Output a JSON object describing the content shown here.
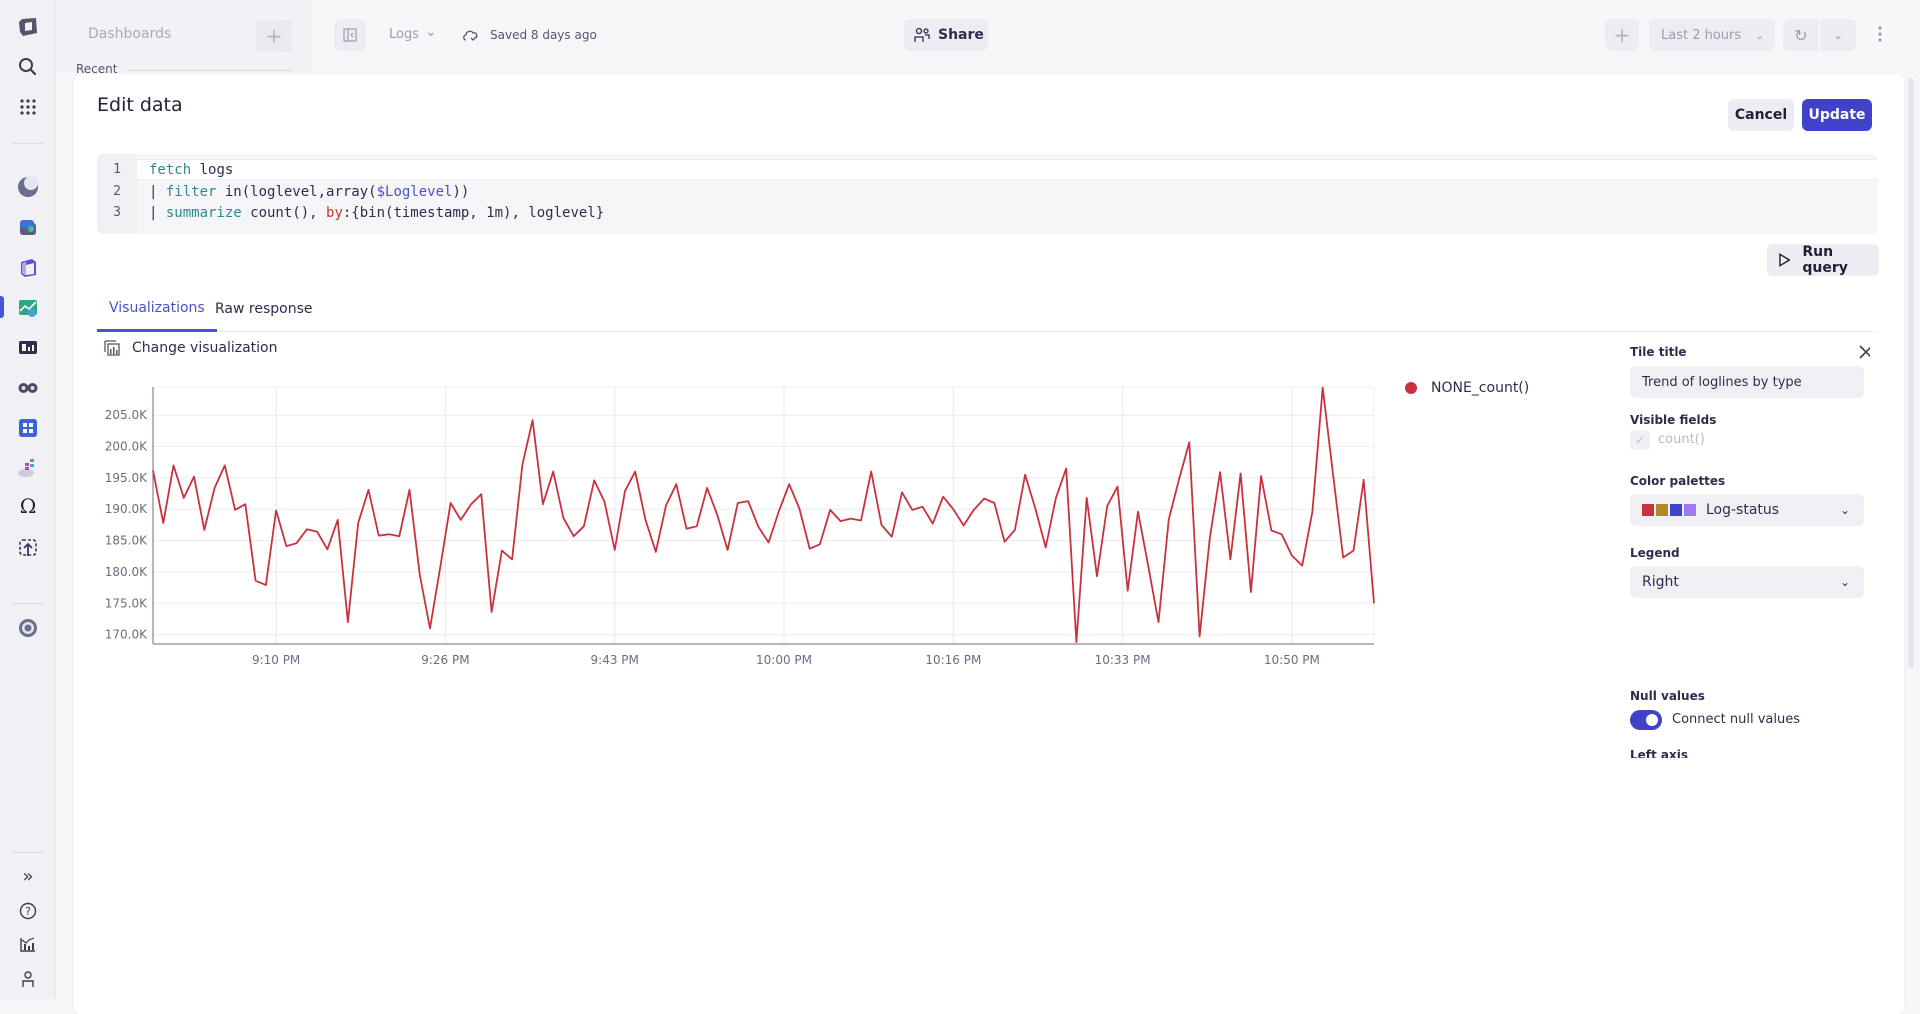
{
  "rail": {
    "icons": [
      "app-logo-icon",
      "search-icon",
      "apps-grid-icon",
      "discover-icon",
      "kubernetes-icon",
      "infrastructure-icon",
      "dashboards-icon",
      "notebooks-icon",
      "observability-icon",
      "workflows-icon",
      "services-icon",
      "omega-icon",
      "upload-icon",
      "settings-icon"
    ],
    "bottom_icons": [
      "expand-icon",
      "help-icon",
      "usage-icon",
      "user-icon"
    ]
  },
  "sidepanel": {
    "title": "Dashboards",
    "recent_label": "Recent"
  },
  "topbar": {
    "dashboard_name": "Logs",
    "saved_status": "Saved 8 days ago",
    "share_label": "Share",
    "timeframe": "Last 2 hours"
  },
  "modal": {
    "title": "Edit data",
    "cancel_label": "Cancel",
    "update_label": "Update",
    "run_query_label": "Run query",
    "code_lines": [
      {
        "num": "1"
      },
      {
        "num": "2"
      },
      {
        "num": "3"
      }
    ],
    "code": {
      "l1_kw": "fetch",
      "l1_rest": " logs",
      "l2_pipe": "| ",
      "l2_kw": "filter",
      "l2_a": " in(loglevel,array(",
      "l2_var": "$Loglevel",
      "l2_b": "))",
      "l3_pipe": "| ",
      "l3_kw": "summarize",
      "l3_a": " count(), ",
      "l3_by": "by",
      "l3_b": ":{bin(timestamp, 1m), loglevel}"
    },
    "tabs": [
      {
        "label": "Visualizations",
        "active": true
      },
      {
        "label": "Raw response",
        "active": false
      }
    ],
    "change_viz_label": "Change visualization"
  },
  "config": {
    "tile_title_label": "Tile title",
    "tile_title_value": "Trend of loglines by type",
    "visible_fields_label": "Visible fields",
    "visible_field": "count()",
    "color_palettes_label": "Color palettes",
    "color_palette_value": "Log-status",
    "palette_colors": [
      "#c8323f",
      "#b8862a",
      "#4043c9",
      "#9b7cf0"
    ],
    "legend_label": "Legend",
    "legend_value": "Right",
    "null_values_label": "Null values",
    "connect_null_label": "Connect null values",
    "connect_null_on": true,
    "left_axis_label": "Left axis"
  },
  "chart_data": {
    "type": "line",
    "title": "",
    "xlabel": "",
    "ylabel": "",
    "ylim": [
      168500,
      209500
    ],
    "yticks": [
      170000,
      175000,
      180000,
      185000,
      190000,
      195000,
      200000,
      205000
    ],
    "ytick_labels": [
      "170.0K",
      "175.0K",
      "180.0K",
      "185.0K",
      "190.0K",
      "195.0K",
      "200.0K",
      "205.0K"
    ],
    "xtick_labels": [
      "9:10 PM",
      "9:26 PM",
      "9:43 PM",
      "10:00 PM",
      "10:16 PM",
      "10:33 PM",
      "10:50 PM"
    ],
    "xtick_minutes": [
      12,
      28.5,
      45,
      61.5,
      78,
      94.5,
      111
    ],
    "x_start": "8:58 PM",
    "x_step_minutes": 1,
    "grid": true,
    "legend": "right",
    "series": [
      {
        "name": "NONE_count()",
        "color": "#c8323f",
        "values": [
          196200,
          187800,
          197000,
          191800,
          195200,
          186700,
          193400,
          197000,
          189900,
          190800,
          178600,
          177900,
          189800,
          184100,
          184600,
          186800,
          186400,
          183600,
          188300,
          172000,
          187800,
          193100,
          185800,
          186000,
          185700,
          193100,
          179500,
          171000,
          180800,
          191000,
          188300,
          190800,
          192400,
          173600,
          183400,
          182000,
          197100,
          204200,
          190800,
          196000,
          188600,
          185700,
          187300,
          194600,
          191200,
          183500,
          192900,
          196000,
          188300,
          183200,
          190600,
          194000,
          186900,
          187300,
          193400,
          189100,
          183500,
          191000,
          191300,
          187200,
          184700,
          189700,
          194000,
          190100,
          183700,
          184400,
          189900,
          188100,
          188500,
          188200,
          196000,
          187500,
          185600,
          192700,
          189900,
          190400,
          187700,
          192000,
          190000,
          187400,
          189900,
          191700,
          191000,
          184800,
          186700,
          195500,
          190100,
          183900,
          191800,
          196500,
          168800,
          191800,
          179300,
          190500,
          193600,
          177000,
          189600,
          180900,
          172000,
          188400,
          194800,
          200700,
          169700,
          185400,
          195900,
          182000,
          195700,
          176800,
          195300,
          186600,
          186000,
          182600,
          181000,
          189600,
          209400,
          195600,
          182300,
          183400,
          194700,
          175000
        ]
      }
    ]
  }
}
